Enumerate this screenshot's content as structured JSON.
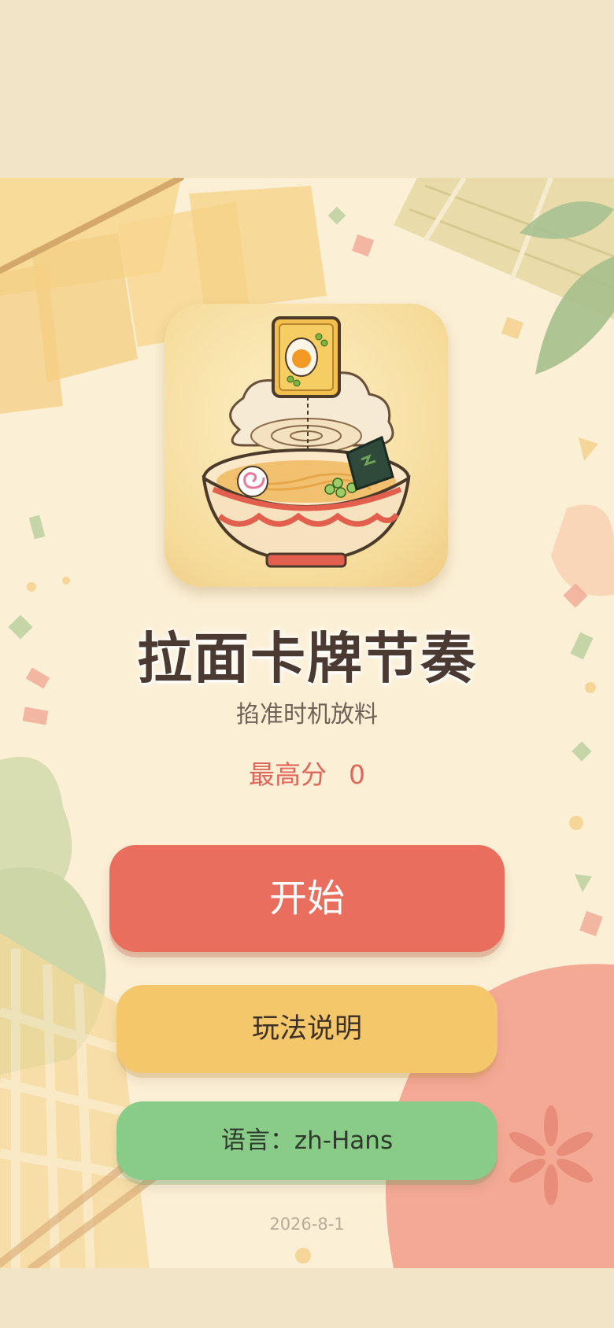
{
  "game": {
    "title": "拉面卡牌节奏",
    "subtitle": "掐准时机放料",
    "highscore_label": "最高分",
    "highscore_value": "0"
  },
  "buttons": {
    "start_label": "开始",
    "help_label": "玩法说明",
    "language_label": "语言：zh-Hans"
  },
  "footer": {
    "version": "2026-8-1"
  },
  "colors": {
    "start_button": "#e96e5d",
    "help_button": "#f4c76b",
    "language_button": "#88cc88",
    "highscore_text": "#e0655a",
    "background": "#fbefd5"
  },
  "icons": [
    "ramen-bowl-icon",
    "egg-card-icon",
    "nori-icon",
    "narutomaki-icon"
  ]
}
